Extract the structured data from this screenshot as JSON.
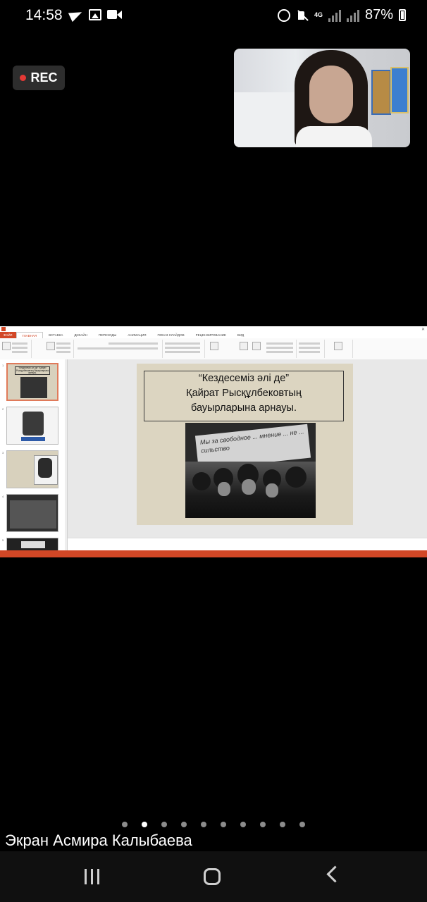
{
  "status_bar": {
    "time": "14:58",
    "left_icons": [
      "telegram-icon",
      "image-icon",
      "video-icon"
    ],
    "right_icons": [
      "alarm-icon",
      "mute-icon",
      "network-4g-icon",
      "signal-icon",
      "signal-icon"
    ],
    "network": "4G",
    "battery": "87%"
  },
  "rec_badge": {
    "label": "REC",
    "color": "#e53935"
  },
  "shared_screen": {
    "app": "PowerPoint",
    "accent_color": "#d24726",
    "ribbon_tabs": [
      "ФАЙЛ",
      "ГЛАВНАЯ",
      "ВСТАВКА",
      "ДИЗАЙН",
      "ПЕРЕХОДЫ",
      "АНИМАЦИЯ",
      "ПОКАЗ СЛАЙДОВ",
      "РЕЦЕНЗИРОВАНИЕ",
      "ВИД"
    ],
    "slide": {
      "title_lines": [
        "“Кездесеміз әлі де”",
        "Қайрат Рысқұлбековтың",
        "бауырларына арнауы."
      ],
      "photo_banner_text": "Мы за свободное ... мнение ... не ... сильство"
    },
    "thumbnails": [
      {
        "number": "1",
        "title": "“Кездесеміз әлі де” Қайрат Рысқұлбековтың бауырларына арнауы."
      },
      {
        "number": "2",
        "title": ""
      },
      {
        "number": "3",
        "title": ""
      },
      {
        "number": "4",
        "title": ""
      },
      {
        "number": "5",
        "title": ""
      }
    ]
  },
  "pager": {
    "count": 10,
    "active_index": 1
  },
  "screen_label": "Экран Асмира Калыбаева",
  "navbar": {
    "recent_label": "recent-apps",
    "home_label": "home",
    "back_label": "back"
  }
}
